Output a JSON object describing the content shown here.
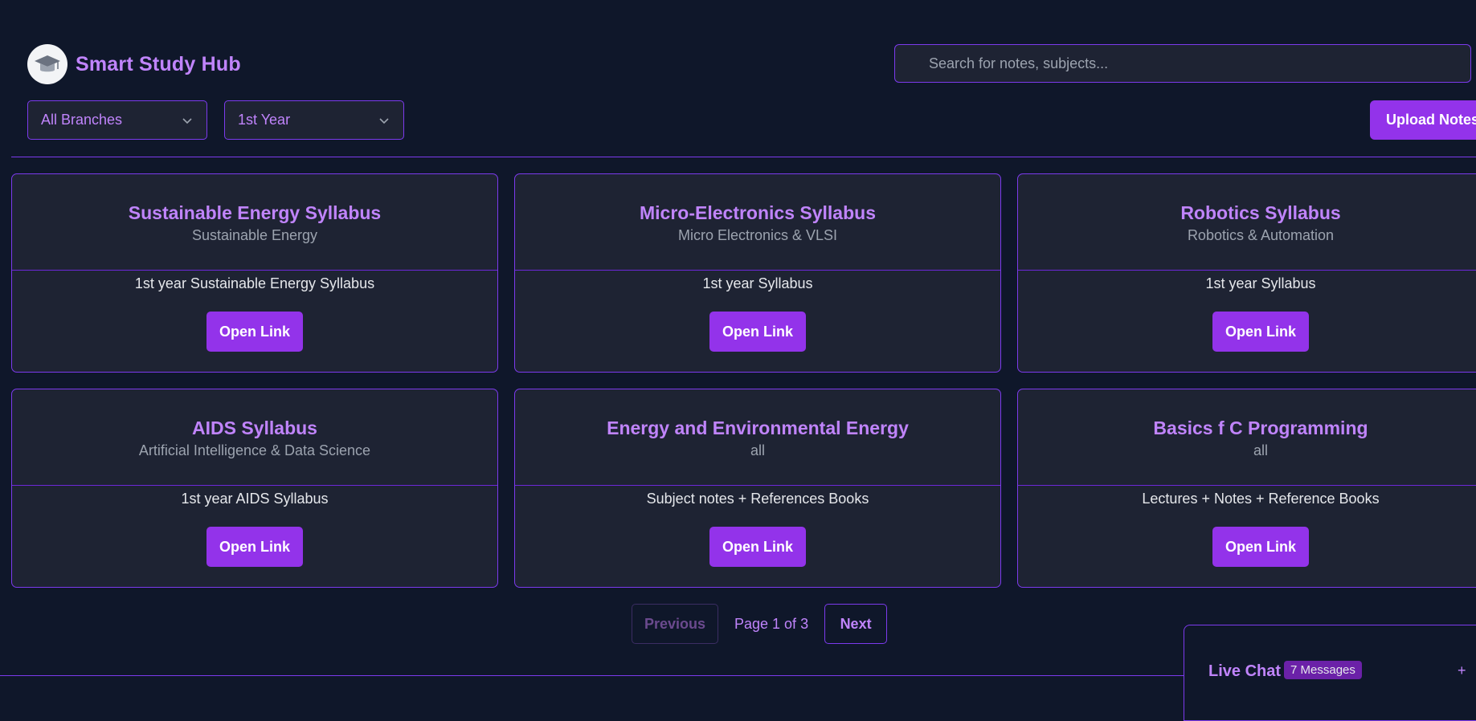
{
  "header": {
    "title": "Smart Study Hub",
    "search_placeholder": "Search for notes, subjects..."
  },
  "filters": {
    "branch": "All Branches",
    "year": "1st Year"
  },
  "upload_label": "Upload Notes",
  "cards": [
    {
      "title": "Sustainable Energy Syllabus",
      "subtitle": "Sustainable Energy",
      "description": "1st year Sustainable Energy Syllabus",
      "button": "Open Link"
    },
    {
      "title": "Micro-Electronics Syllabus",
      "subtitle": "Micro Electronics & VLSI",
      "description": "1st year Syllabus",
      "button": "Open Link"
    },
    {
      "title": "Robotics Syllabus",
      "subtitle": "Robotics & Automation",
      "description": "1st year Syllabus",
      "button": "Open Link"
    },
    {
      "title": "AIDS Syllabus",
      "subtitle": "Artificial Intelligence & Data Science",
      "description": "1st year AIDS Syllabus",
      "button": "Open Link"
    },
    {
      "title": "Energy and Environmental Energy",
      "subtitle": "all",
      "description": "Subject notes + References Books",
      "button": "Open Link"
    },
    {
      "title": "Basics f C Programming",
      "subtitle": "all",
      "description": "Lectures + Notes + Reference Books",
      "button": "Open Link"
    }
  ],
  "pagination": {
    "previous": "Previous",
    "info": "Page 1 of 3",
    "next": "Next"
  },
  "chat": {
    "title": "Live Chat",
    "badge": "7 Messages",
    "toggle": "+"
  },
  "colors": {
    "background": "#0f172a",
    "card": "#1e2333",
    "accent": "#9333ea",
    "accent_text": "#c084fc",
    "border": "#7c3aed"
  }
}
